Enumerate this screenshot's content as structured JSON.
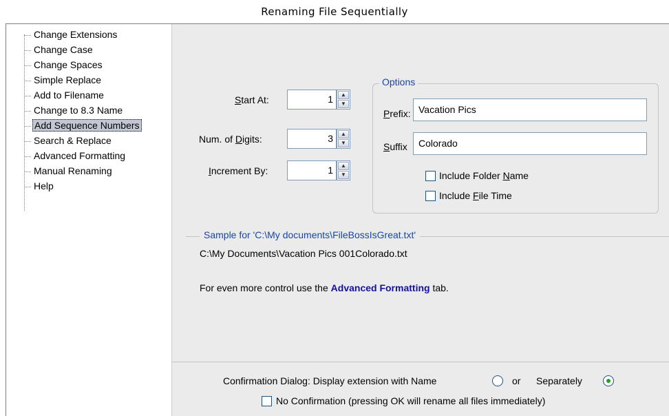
{
  "caption": "Renaming File Sequentially",
  "tree": {
    "items": [
      {
        "label": "Change Extensions"
      },
      {
        "label": "Change Case"
      },
      {
        "label": "Change Spaces"
      },
      {
        "label": "Simple Replace"
      },
      {
        "label": "Add to Filename"
      },
      {
        "label": "Change to 8.3 Name"
      },
      {
        "label": "Add Sequence Numbers",
        "selected": true
      },
      {
        "label": "Search & Replace"
      },
      {
        "label": "Advanced Formatting"
      },
      {
        "label": "Manual Renaming"
      },
      {
        "label": "Help"
      }
    ]
  },
  "sequence": {
    "start_at": {
      "label_pre": "",
      "label_u": "S",
      "label_post": "tart At:",
      "value": "1"
    },
    "num_digits": {
      "label_pre": "Num. of ",
      "label_u": "D",
      "label_post": "igits:",
      "value": "3"
    },
    "increment_by": {
      "label_pre": "",
      "label_u": "I",
      "label_post": "ncrement By:",
      "value": "1"
    }
  },
  "options": {
    "title": "Options",
    "prefix_label_pre": "P",
    "prefix_label_post": "refix:",
    "prefix_value": "Vacation Pics",
    "suffix_label_pre": "S",
    "suffix_label_post": "uffix",
    "suffix_value": "Colorado",
    "include_folder_pre": "Include Folder ",
    "include_folder_u": "N",
    "include_folder_post": "ame",
    "include_folder_checked": false,
    "include_time_pre": "Include ",
    "include_time_u": "F",
    "include_time_post": "ile Time",
    "include_time_checked": false
  },
  "sample": {
    "title": "Sample for 'C:\\My documents\\FileBossIsGreat.txt'",
    "result": "C:\\My Documents\\Vacation Pics 001Colorado.txt"
  },
  "hint": {
    "pre": "For even more control use the ",
    "link": "Advanced Formatting",
    "post": " tab."
  },
  "confirm": {
    "label": "Confirmation Dialog: Display extension with Name",
    "or": "or",
    "separately": "Separately",
    "selected": "separately",
    "no_confirm_label": "No Confirmation (pressing OK will rename all files immediately)",
    "no_confirm_checked": false
  }
}
